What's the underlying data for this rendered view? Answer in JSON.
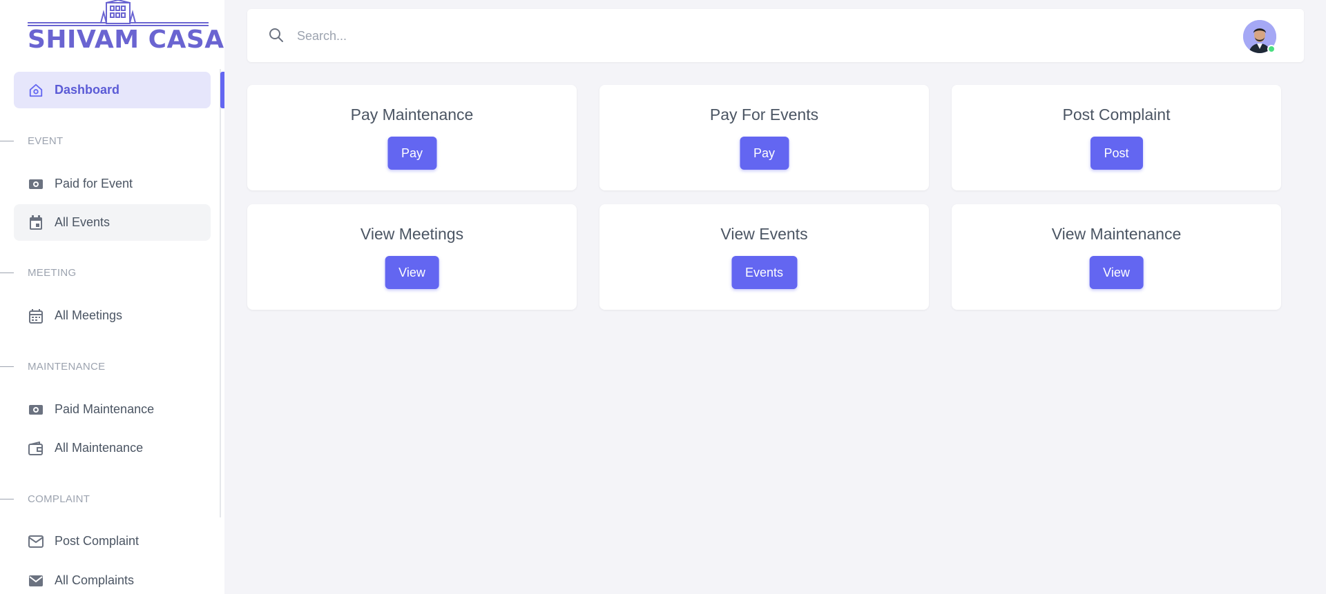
{
  "brand": {
    "name": "SHIVAM CASA",
    "accent": "#6a64d1"
  },
  "search": {
    "placeholder": "Search..."
  },
  "user": {
    "avatar_icon": "user-avatar",
    "status": "online",
    "status_color": "#4ade80"
  },
  "sidebar": {
    "dashboard": {
      "label": "Dashboard",
      "icon": "home-icon"
    },
    "sections": [
      {
        "title": "EVENT",
        "items": [
          {
            "label": "Paid for Event",
            "icon": "money-icon"
          },
          {
            "label": "All Events",
            "icon": "calendar-event-icon"
          }
        ]
      },
      {
        "title": "MEETING",
        "items": [
          {
            "label": "All Meetings",
            "icon": "calendar-icon"
          }
        ]
      },
      {
        "title": "MAINTENANCE",
        "items": [
          {
            "label": "Paid Maintenance",
            "icon": "money-icon"
          },
          {
            "label": "All Maintenance",
            "icon": "wallet-icon"
          }
        ]
      },
      {
        "title": "COMPLAINT",
        "items": [
          {
            "label": "Post Complaint",
            "icon": "mail-outline-icon"
          },
          {
            "label": "All Complaints",
            "icon": "mail-icon"
          }
        ]
      }
    ]
  },
  "cards": [
    {
      "title": "Pay Maintenance",
      "button": "Pay"
    },
    {
      "title": "Pay For Events",
      "button": "Pay"
    },
    {
      "title": "Post Complaint",
      "button": "Post"
    },
    {
      "title": "View Meetings",
      "button": "View"
    },
    {
      "title": "View Events",
      "button": "Events"
    },
    {
      "title": "View Maintenance",
      "button": "View"
    }
  ],
  "colors": {
    "primary": "#6366f1",
    "active_bg": "#e6e6fb",
    "background": "#f4f4f8"
  }
}
